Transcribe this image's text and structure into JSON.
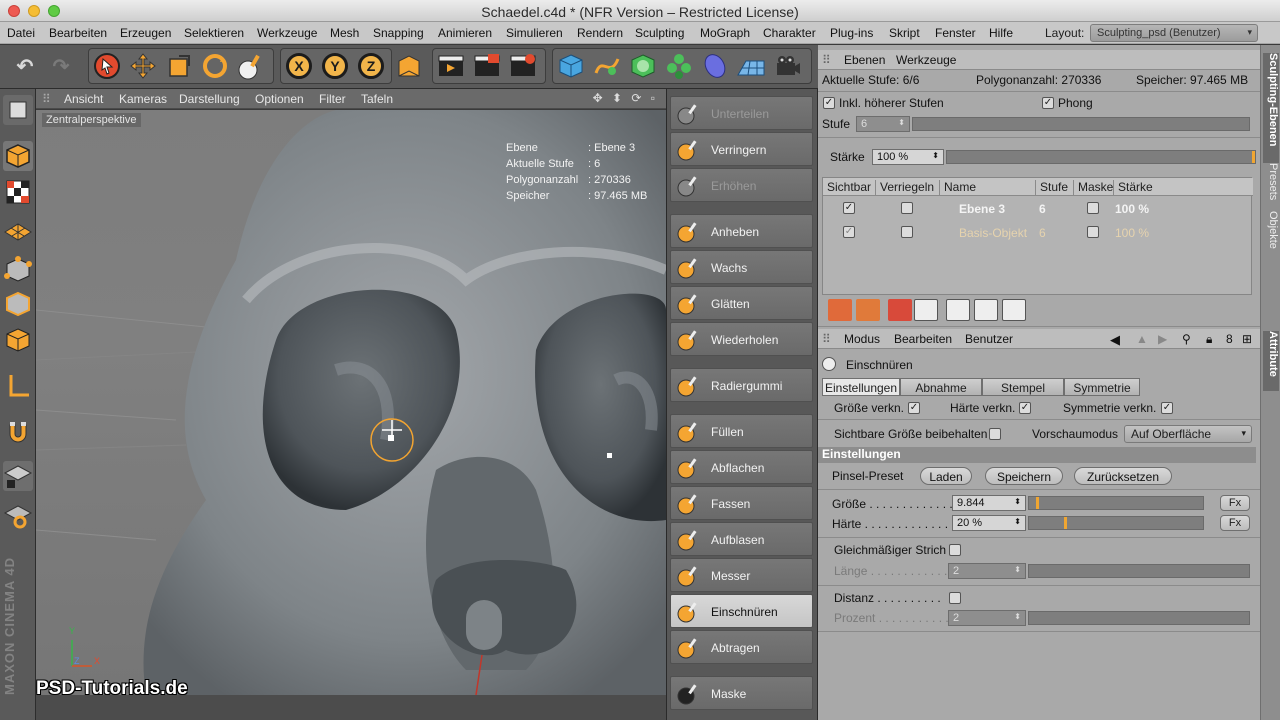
{
  "window": {
    "title": "Schaedel.c4d * (NFR Version – Restricted License)"
  },
  "menubar": {
    "items": [
      "Datei",
      "Bearbeiten",
      "Erzeugen",
      "Selektieren",
      "Werkzeuge",
      "Mesh",
      "Snapping",
      "Animieren",
      "Simulieren",
      "Rendern",
      "Sculpting",
      "MoGraph",
      "Charakter",
      "Plug-ins",
      "Skript",
      "Fenster",
      "Hilfe"
    ],
    "layout_label": "Layout:",
    "layout_value": "Sculpting_psd (Benutzer)"
  },
  "toolbar": {
    "axis_x": "X",
    "axis_y": "Y",
    "axis_z": "Z"
  },
  "viewport": {
    "menu": [
      "Ansicht",
      "Kameras",
      "Darstellung",
      "Optionen",
      "Filter",
      "Tafeln"
    ],
    "nav_icons": "✥ ⬍ ⟳ ▫",
    "label": "Zentralperspektive",
    "hud": [
      {
        "k": "Ebene",
        "v": ": Ebene 3"
      },
      {
        "k": "Aktuelle Stufe",
        "v": ": 6"
      },
      {
        "k": "Polygonanzahl",
        "v": ": 270336"
      },
      {
        "k": "Speicher",
        "v": ": 97.465 MB"
      }
    ],
    "watermark": "PSD-Tutorials.de",
    "brand": "MAXON CINEMA 4D",
    "axes": {
      "y": "Y",
      "x": "X",
      "z": "Z"
    }
  },
  "sculpt_tools": [
    {
      "label": "Unterteilen",
      "disabled": true
    },
    {
      "label": "Verringern",
      "disabled": false
    },
    {
      "label": "Erhöhen",
      "disabled": true
    },
    {
      "label": "Anheben",
      "disabled": false
    },
    {
      "label": "Wachs",
      "disabled": false
    },
    {
      "label": "Glätten",
      "disabled": false
    },
    {
      "label": "Wiederholen",
      "disabled": false
    },
    {
      "label": "Radiergummi",
      "disabled": false
    },
    {
      "label": "Füllen",
      "disabled": false
    },
    {
      "label": "Abflachen",
      "disabled": false
    },
    {
      "label": "Fassen",
      "disabled": false
    },
    {
      "label": "Aufblasen",
      "disabled": false
    },
    {
      "label": "Messer",
      "disabled": false
    },
    {
      "label": "Einschnüren",
      "disabled": false,
      "active": true
    },
    {
      "label": "Abtragen",
      "disabled": false
    },
    {
      "label": "Maske",
      "disabled": false
    }
  ],
  "layers_panel": {
    "menu": [
      "Ebenen",
      "Werkzeuge"
    ],
    "current_level_label": "Aktuelle Stufe: 6/6",
    "poly_label": "Polygonanzahl: 270336",
    "memory_label": "Speicher: 97.465 MB",
    "include_higher": "Inkl. höherer Stufen",
    "phong": "Phong",
    "stufe_label": "Stufe",
    "stufe_value": "6",
    "staerke_label": "Stärke",
    "staerke_value": "100 %",
    "columns": [
      "Sichtbar",
      "Verriegeln",
      "Name",
      "Stufe",
      "Maske",
      "Stärke"
    ],
    "rows": [
      {
        "name": "Ebene 3",
        "level": "6",
        "strength": "100 %",
        "dim": false
      },
      {
        "name": "Basis-Objekt",
        "level": "6",
        "strength": "100 %",
        "dim": true
      }
    ]
  },
  "attributes": {
    "menu": [
      "Modus",
      "Bearbeiten",
      "Benutzer"
    ],
    "tool_name": "Einschnüren",
    "tabs": [
      "Einstellungen",
      "Abnahme",
      "Stempel",
      "Symmetrie"
    ],
    "size_link": "Größe verkn.",
    "hardness_link": "Härte verkn.",
    "symmetry_link": "Symmetrie verkn.",
    "keep_visible_size": "Sichtbare Größe beibehalten",
    "preview_mode_label": "Vorschaumodus",
    "preview_mode_value": "Auf Oberfläche",
    "section": "Einstellungen",
    "brush_preset": "Pinsel-Preset",
    "btn_load": "Laden",
    "btn_save": "Speichern",
    "btn_reset": "Zurücksetzen",
    "size_label": "Größe",
    "size_value": "9.844",
    "size_fraction": 0.04,
    "hardness_label": "Härte",
    "hardness_value": "20 %",
    "hardness_fraction": 0.2,
    "fx": "Fx",
    "even_stroke": "Gleichmäßiger Strich",
    "length_label": "Länge",
    "length_value": "2",
    "distance_label": "Distanz",
    "percent_label": "Prozent",
    "percent_value": "2"
  },
  "side_tabs": [
    "Sculpting-Ebenen",
    "Presets",
    "Objekte",
    "Attribute"
  ]
}
